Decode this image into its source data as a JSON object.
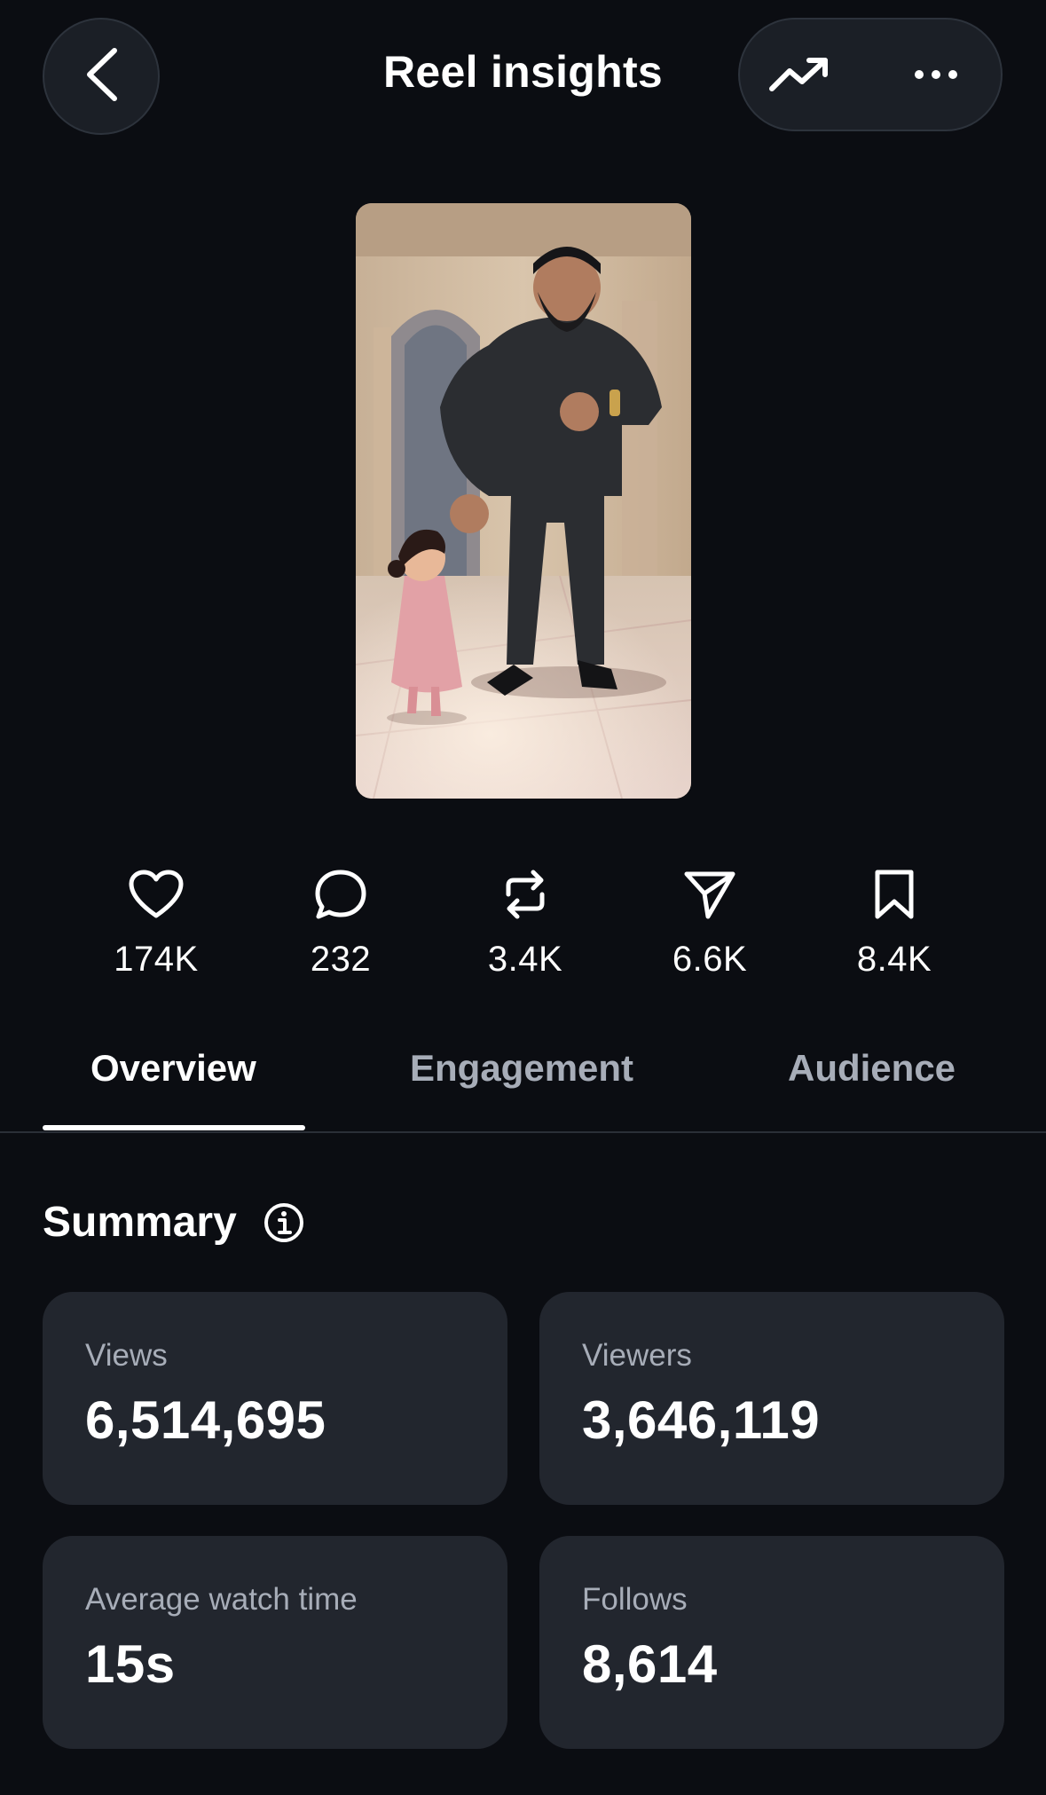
{
  "header": {
    "title": "Reel insights",
    "back_icon": "chevron-left-icon",
    "trend_icon": "trending-up-icon",
    "more_icon": "more-horizontal-icon"
  },
  "stats": [
    {
      "icon": "heart-icon",
      "value": "174K"
    },
    {
      "icon": "comment-icon",
      "value": "232"
    },
    {
      "icon": "repost-icon",
      "value": "3.4K"
    },
    {
      "icon": "share-icon",
      "value": "6.6K"
    },
    {
      "icon": "bookmark-icon",
      "value": "8.4K"
    }
  ],
  "tabs": [
    {
      "label": "Overview",
      "active": true
    },
    {
      "label": "Engagement",
      "active": false
    },
    {
      "label": "Audience",
      "active": false
    }
  ],
  "summary": {
    "title": "Summary",
    "cards": [
      {
        "label": "Views",
        "value": "6,514,695"
      },
      {
        "label": "Viewers",
        "value": "3,646,119"
      },
      {
        "label": "Average watch time",
        "value": "15s"
      },
      {
        "label": "Follows",
        "value": "8,614"
      }
    ]
  },
  "colors": {
    "background": "#0b0d12",
    "card": "#22262e",
    "muted_text": "#a7adb8",
    "text": "#ffffff"
  }
}
